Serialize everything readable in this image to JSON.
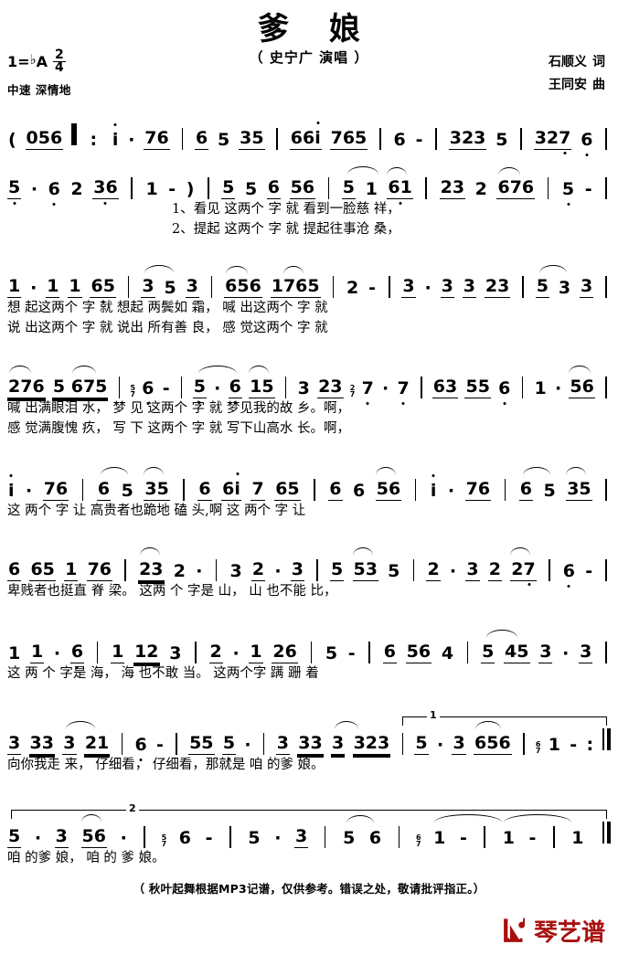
{
  "header": {
    "title": "爹 娘",
    "singer": "（ 史宁广 演唱 ）",
    "key_label": "1=",
    "key_flat": "♭",
    "key_letter": "A",
    "time_numerator": "2",
    "time_denominator": "4",
    "tempo": "中速 深情地",
    "lyricist": "石顺义",
    "lyricist_role": "词",
    "composer": "王同安",
    "composer_role": "曲"
  },
  "staves": [
    {
      "id": "staff-1",
      "notes": "(056 ‖: i · 76 | 6 5 35 | 66i 765 | 6 - | 3235 | 327 6 |",
      "lyrics_1": "",
      "lyrics_2": ""
    },
    {
      "id": "staff-2",
      "notes": "5· 6 2 36 | 1 - ) | 5 5 6 56 | 5 1 61 | 23 2 676 | 5 - |",
      "lyrics_1": "1、看见 这两个 字 就 看到一脸慈 祥，",
      "lyrics_2": "2、提起 这两个 字 就 提起往事沧 桑，"
    },
    {
      "id": "staff-3",
      "notes": "1· 1 1 65 | 3 5 3 | 656 1765 | 2 - | 3· 3 3 23 | 5 3 3 |",
      "lyrics_1": "想 起这两个 字 就 想起 两鬓如 霜， 喊 出这两个 字 就",
      "lyrics_2": "说 出这两个 字 就 说出 所有善 良， 感 觉这两个 字 就"
    },
    {
      "id": "staff-4",
      "notes": "276 5 675 | 6 - | 5· 6 15 | 3 23 7· 7 | 63 55 6 | 1 · 56 |",
      "lyrics_1": "喊 出满眼泪 水， 梦 见 这两个 字 就 梦见我的故 乡。啊，",
      "lyrics_2": "感 觉满腹愧 疚， 写 下 这两个 字 就 写下山高水 长。啊，"
    },
    {
      "id": "staff-5",
      "notes": "i · 76 | 6 5 35 | 6 6i 7 65 | 6 6 56 | i · 76 | 6 5 35 |",
      "lyrics_1": "这 两个 字 让 高贵者也跪地 磕 头,啊 这 两个 字 让",
      "lyrics_2": ""
    },
    {
      "id": "staff-6",
      "notes": "6 65 1 76 | 23 2 · | 3 2· 3 | 5 53 5 | 2· 3 2 27 | 6 - |",
      "lyrics_1": "卑贱者也挺直 脊 梁。 这两 个 字是 山， 山 也不能 比，",
      "lyrics_2": ""
    },
    {
      "id": "staff-7",
      "notes": "1 1· 6 | 1 12 3 | 2· 1 26 | 5 - | 6 56 4 | 5 45 3· 3 |",
      "lyrics_1": "这 两 个 字是 海， 海 也不敢 当。 这两个字 蹒 跚 着",
      "lyrics_2": ""
    },
    {
      "id": "staff-8",
      "notes": "3 33 3 21 | 6 - | 55 5· | 3 33 3 323 | 5· 3 656 | 1 - :‖",
      "lyrics_1": "向你我走 来， 仔细看， 仔细看，那就是 咱 的爹 娘。",
      "lyrics_2": "",
      "volta": "1"
    },
    {
      "id": "staff-9",
      "notes": "5· 3 56· | 6 - | 5 · 3 | 5 6 | 1 - | 1 - | 1 ‖",
      "lyrics_1": "咱 的爹 娘， 咱 的 爹 娘。",
      "lyrics_2": "",
      "volta": "2"
    }
  ],
  "footer": {
    "note": "（ 秋叶起舞根据MP3记谱，仅供参考。错误之处，敬请批评指正。）",
    "brand_text": "琴艺谱",
    "brand_color": "#a81010"
  }
}
